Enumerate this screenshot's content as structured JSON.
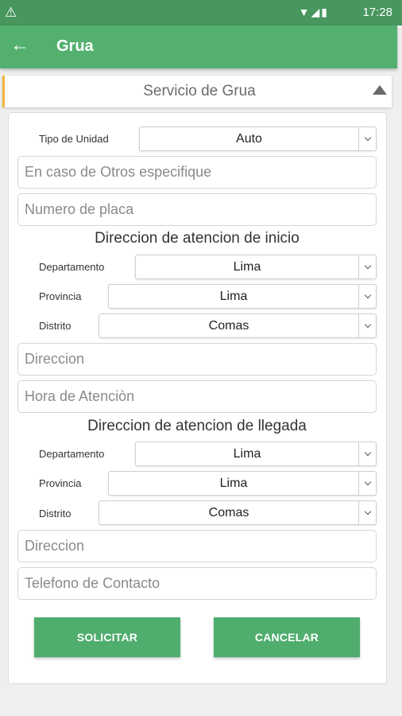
{
  "status_bar": {
    "time": "17:28",
    "warning_icon": "warning-icon",
    "status_icons": [
      "wifi-icon",
      "signal-icon",
      "battery-icon"
    ]
  },
  "app_bar": {
    "title": "Grua",
    "back_icon": "arrow-left-icon"
  },
  "section": {
    "title": "Servicio de Grua",
    "collapse_icon": "triangle-up-icon"
  },
  "form": {
    "tipo_unidad": {
      "label": "Tipo de Unidad",
      "value": "Auto"
    },
    "otros_placeholder": "En caso de Otros especifique",
    "placa_placeholder": "Numero de placa",
    "inicio": {
      "heading": "Direccion de atencion de inicio",
      "departamento": {
        "label": "Departamento",
        "value": "Lima"
      },
      "provincia": {
        "label": "Provincia",
        "value": "Lima"
      },
      "distrito": {
        "label": "Distrito",
        "value": "Comas"
      },
      "direccion_placeholder": "Direccion",
      "hora_placeholder": "Hora de Atenciòn"
    },
    "llegada": {
      "heading": "Direccion de atencion de llegada",
      "departamento": {
        "label": "Departamento",
        "value": "Lima"
      },
      "provincia": {
        "label": "Provincia",
        "value": "Lima"
      },
      "distrito": {
        "label": "Distrito",
        "value": "Comas"
      },
      "direccion_placeholder": "Direccion",
      "telefono_placeholder": "Telefono de Contacto"
    },
    "buttons": {
      "solicitar": "SOLICITAR",
      "cancelar": "CANCELAR"
    }
  },
  "colors": {
    "status_bar": "#47975f",
    "app_bar": "#53b06f",
    "button": "#4fad6d",
    "accent": "#f2b53a"
  }
}
